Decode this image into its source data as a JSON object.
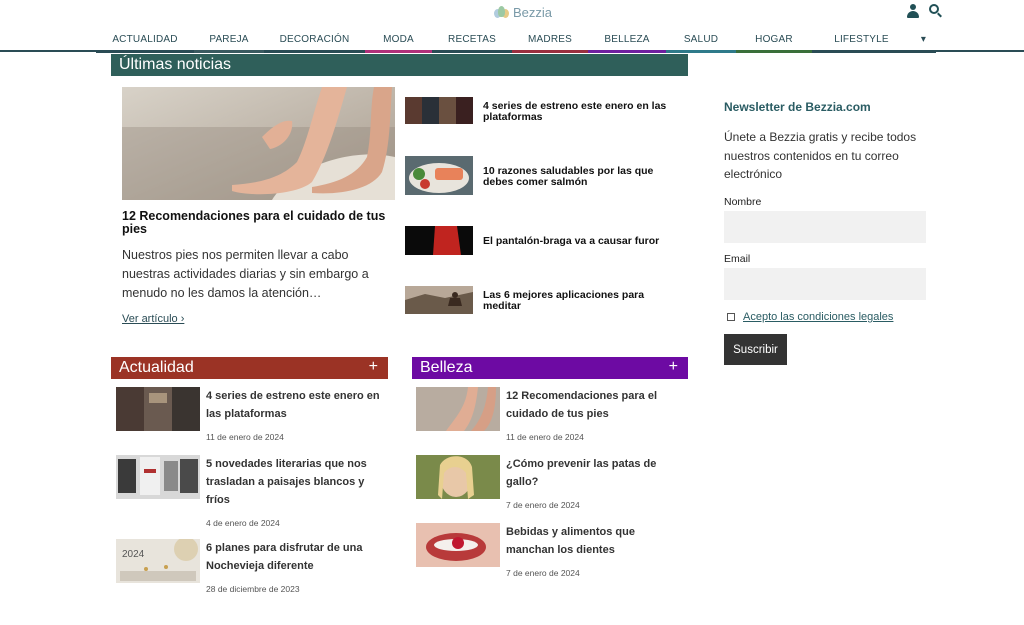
{
  "header": {
    "logo_text": "Bezzia",
    "nav": [
      {
        "label": "ACTUALIDAD",
        "color": "#8b2f2f"
      },
      {
        "label": "PAREJA",
        "color": "#9b2f6f"
      },
      {
        "label": "DECORACIÓN",
        "color": "#6f6f6f"
      },
      {
        "label": "MODA",
        "color": "#b0307a"
      },
      {
        "label": "RECETAS",
        "color": "#4a7a3a"
      },
      {
        "label": "MADRES",
        "color": "#9a2f3f"
      },
      {
        "label": "BELLEZA",
        "color": "#6f1fa0"
      },
      {
        "label": "SALUD",
        "color": "#2f7a8a"
      },
      {
        "label": "HOGAR",
        "color": "#3a6f3a"
      },
      {
        "label": "LIFESTYLE",
        "color": "#2a4c55"
      }
    ],
    "nav_more": "▾"
  },
  "latest": {
    "heading": "Últimas noticias",
    "heading_color": "#2f5f5a",
    "hero": {
      "title": "12 Recomendaciones para el cuidado de tus pies",
      "text": "Nuestros pies nos permiten llevar a cabo nuestras actividades diarias y sin embargo a menudo no les damos la atención…",
      "link": "Ver artículo ›"
    },
    "side": [
      {
        "title": "4 series de estreno este enero en las plataformas"
      },
      {
        "title": "10 razones saludables por las que debes comer salmón"
      },
      {
        "title": "El pantalón-braga va a causar furor"
      },
      {
        "title": "Las 6 mejores aplicaciones para meditar"
      }
    ]
  },
  "actualidad": {
    "heading": "Actualidad",
    "plus": "+",
    "color": "#9b3325",
    "items": [
      {
        "title": "4 series de estreno este enero en las plataformas",
        "date": "11 de enero de 2024"
      },
      {
        "title": "5 novedades literarias que nos trasladan a paisajes blancos y fríos",
        "date": "4 de enero de 2024"
      },
      {
        "title": "6 planes para disfrutar de una Nochevieja diferente",
        "date": "28 de diciembre de 2023",
        "thumb_text": "2024"
      }
    ]
  },
  "belleza": {
    "heading": "Belleza",
    "plus": "+",
    "color": "#6d0aa3",
    "items": [
      {
        "title": "12 Recomendaciones para el cuidado de tus pies",
        "date": "11 de enero de 2024"
      },
      {
        "title": "¿Cómo prevenir las patas de gallo?",
        "date": "7 de enero de 2024"
      },
      {
        "title": "Bebidas y alimentos que manchan los dientes",
        "date": "7 de enero de 2024"
      }
    ]
  },
  "newsletter": {
    "title": "Newsletter de Bezzia.com",
    "text": "Únete a Bezzia gratis y recibe todos nuestros contenidos en tu correo electrónico",
    "name_label": "Nombre",
    "email_label": "Email",
    "accept_label": "Acepto las condiciones legales",
    "submit_label": "Suscribir"
  }
}
